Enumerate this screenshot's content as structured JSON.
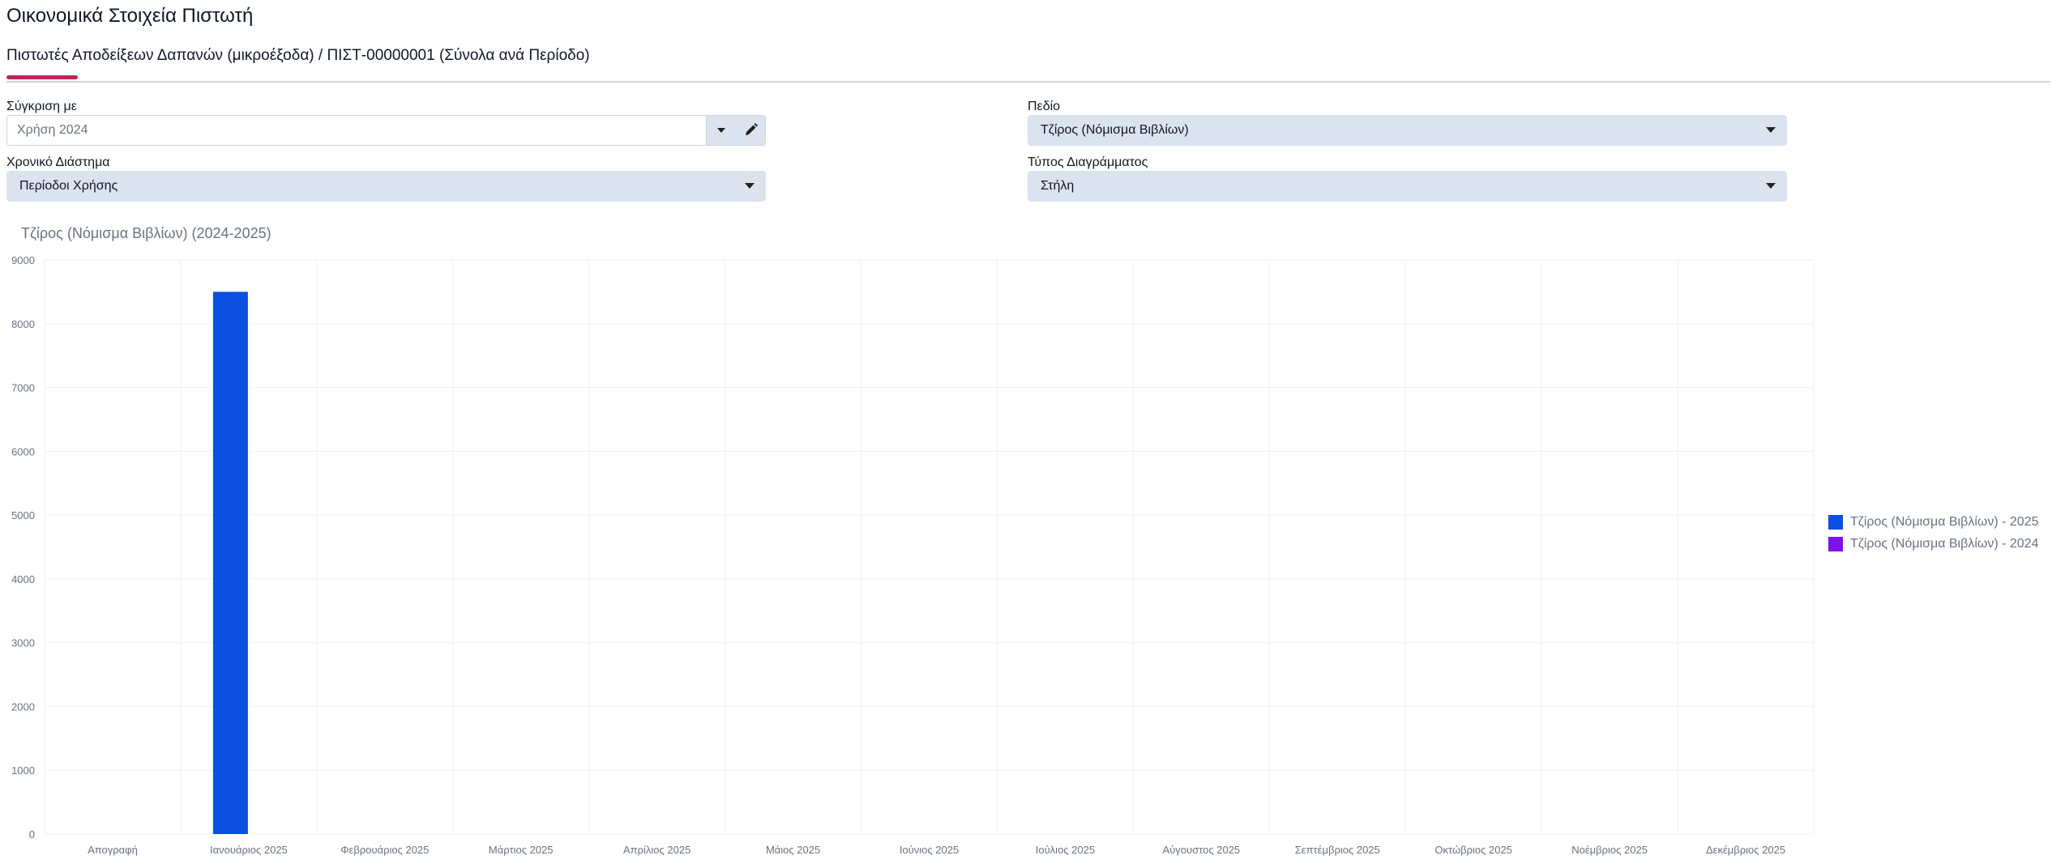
{
  "page": {
    "title": "Οικονομικά Στοιχεία Πιστωτή"
  },
  "tab": {
    "label": "Πιστωτές Αποδείξεων Δαπανών (μικροέξοδα) / ΠΙΣΤ-00000001 (Σύνολα ανά Περίοδο)"
  },
  "filters": {
    "compare_label": "Σύγκριση με",
    "compare_value": "Χρήση 2024",
    "period_label": "Χρονικό Διάστημα",
    "period_value": "Περίοδοι Χρήσης",
    "field_label": "Πεδίο",
    "field_value": "Τζίρος (Νόμισμα Βιβλίων)",
    "chart_type_label": "Τύπος Διαγράμματος",
    "chart_type_value": "Στήλη"
  },
  "icons": {
    "dropdown": "chevron-down-icon",
    "edit": "pencil-icon"
  },
  "chart_data": {
    "type": "bar",
    "title": "Τζίρος (Νόμισμα Βιβλίων) (2024-2025)",
    "categories": [
      "Απογραφή",
      "Ιανουάριος 2025",
      "Φεβρουάριος 2025",
      "Μάρτιος 2025",
      "Απρίλιος 2025",
      "Μάιος 2025",
      "Ιούνιος 2025",
      "Ιούλιος 2025",
      "Αύγουστος 2025",
      "Σεπτέμβριος 2025",
      "Οκτώβριος 2025",
      "Νοέμβριος 2025",
      "Δεκέμβριος 2025"
    ],
    "series": [
      {
        "name": "Τζίρος (Νόμισμα Βιβλίων) - 2025",
        "color": "#0b4fe0",
        "values": [
          0,
          8500,
          0,
          0,
          0,
          0,
          0,
          0,
          0,
          0,
          0,
          0,
          0
        ]
      },
      {
        "name": "Τζίρος (Νόμισμα Βιβλίων) - 2024",
        "color": "#7e13e8",
        "values": [
          0,
          0,
          0,
          0,
          0,
          0,
          0,
          0,
          0,
          0,
          0,
          0,
          0
        ]
      }
    ],
    "ylim": [
      0,
      9000
    ],
    "yticks": [
      0,
      1000,
      2000,
      3000,
      4000,
      5000,
      6000,
      7000,
      8000,
      9000
    ],
    "grid": true,
    "legend": "right"
  }
}
